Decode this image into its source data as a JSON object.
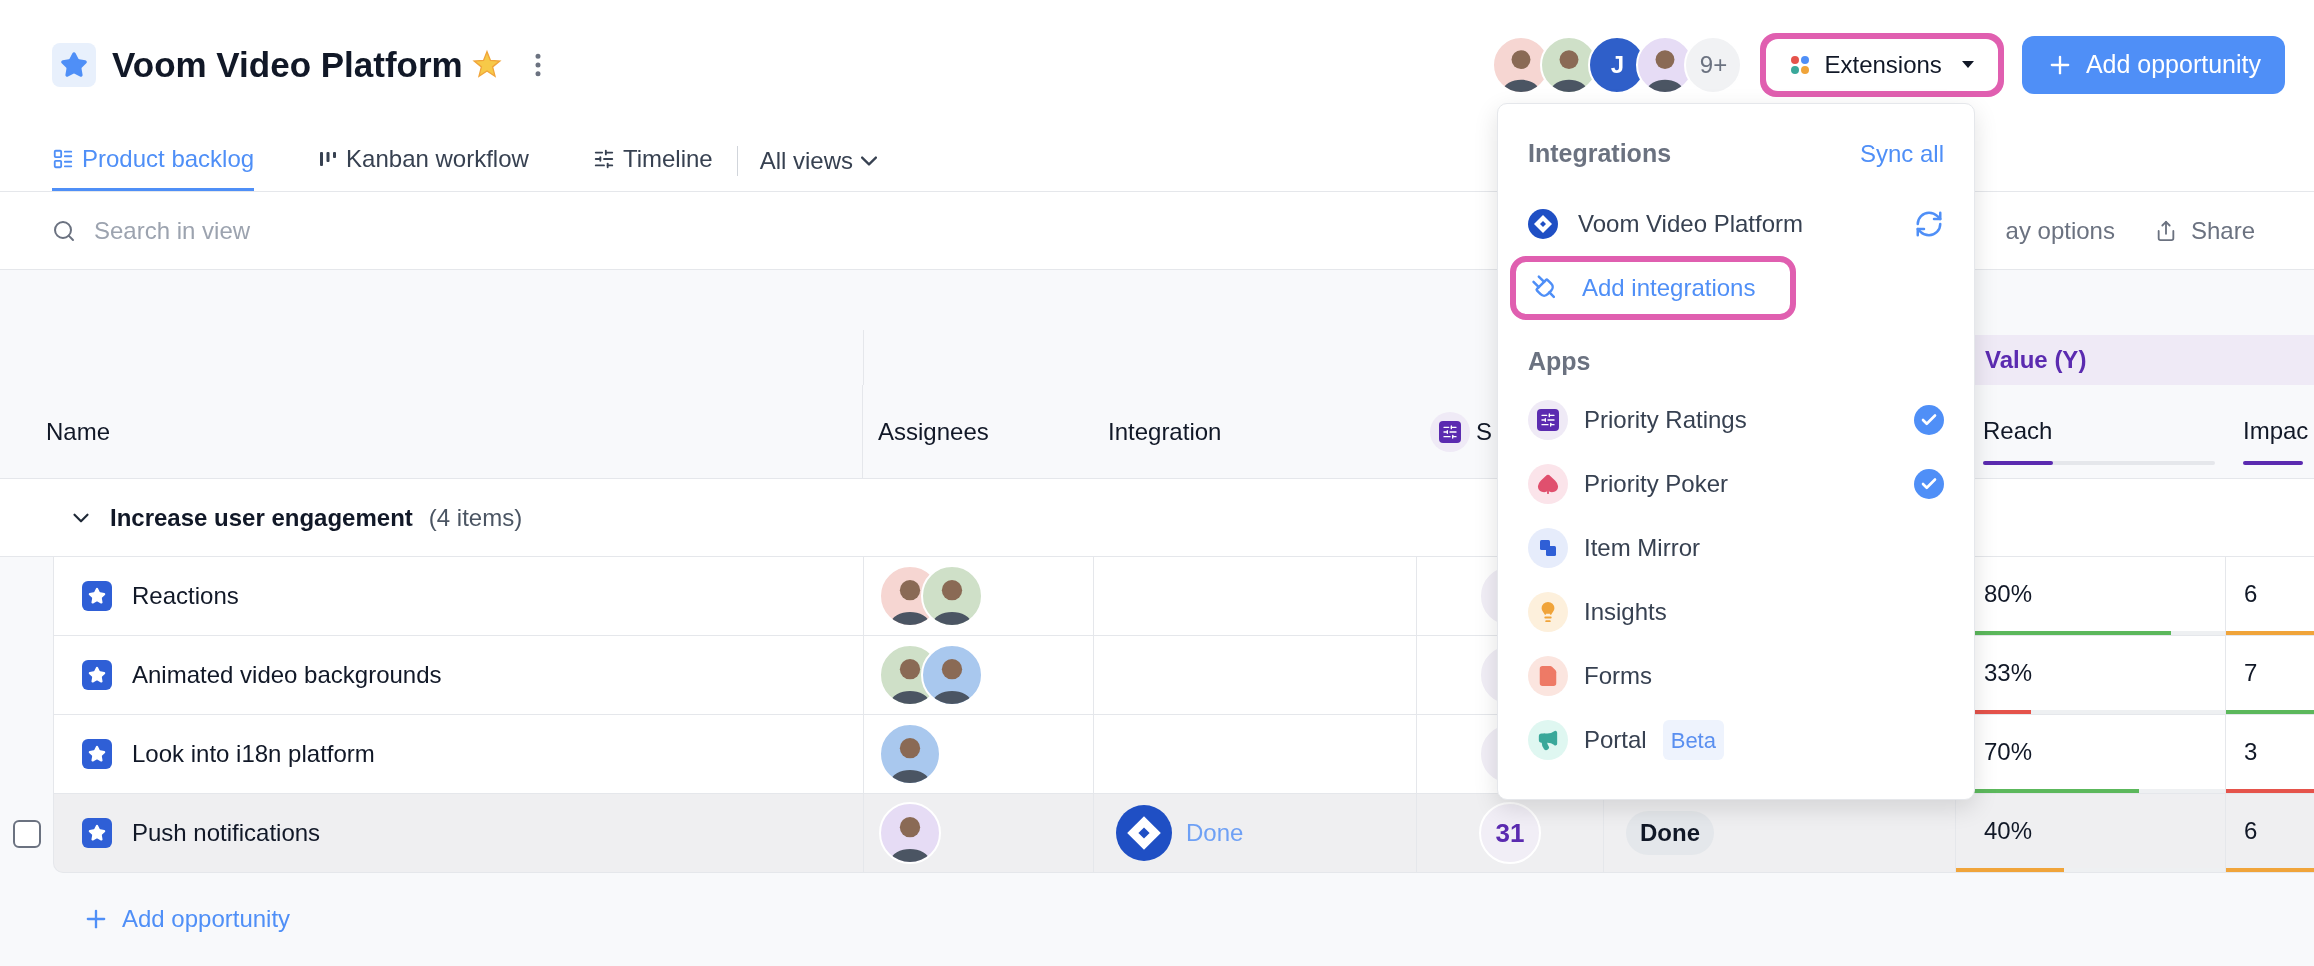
{
  "project": {
    "title": "Voom Video Platform"
  },
  "header_avatars": [
    {
      "kind": "photo"
    },
    {
      "kind": "photo"
    },
    {
      "kind": "initials",
      "text": "J"
    },
    {
      "kind": "photo"
    },
    {
      "kind": "more",
      "text": "9+"
    }
  ],
  "extensions_button": {
    "label": "Extensions",
    "highlighted": true
  },
  "add_button": {
    "label": "Add opportunity"
  },
  "tabs": [
    {
      "label": "Product backlog",
      "kind": "list",
      "selected": true
    },
    {
      "label": "Kanban workflow",
      "kind": "kanban",
      "selected": false
    },
    {
      "label": "Timeline",
      "kind": "timeline",
      "selected": false
    }
  ],
  "all_views": {
    "label": "All views"
  },
  "search": {
    "placeholder": "Search in view"
  },
  "toolbar": [
    {
      "label": "ay options",
      "kind": "display"
    },
    {
      "label": "Share",
      "kind": "share"
    }
  ],
  "table": {
    "group_header": "Value (Y)",
    "columns": [
      {
        "label": "Name",
        "kind": "name"
      },
      {
        "label": "Assignees",
        "kind": "assignees"
      },
      {
        "label": "Integration",
        "kind": "integration"
      },
      {
        "label": "S",
        "kind": "score"
      },
      {
        "label": "Reach",
        "kind": "reach",
        "level": 0.3
      },
      {
        "label": "Impac",
        "kind": "impact"
      }
    ],
    "group": {
      "title": "Increase user engagement",
      "count": "(4 items)",
      "expanded": true
    },
    "rows": [
      {
        "name": "Reactions",
        "hovered": false,
        "assignees": [
          {
            "kind": "photo"
          },
          {
            "kind": "photo"
          }
        ],
        "reach": {
          "value": "80%",
          "level": 0.8,
          "color": "#5cb85c"
        },
        "impact": {
          "value": "6",
          "color": "#f0a43a"
        }
      },
      {
        "name": "Animated video backgrounds",
        "hovered": false,
        "assignees": [
          {
            "kind": "photo"
          },
          {
            "kind": "photo"
          }
        ],
        "reach": {
          "value": "33%",
          "level": 0.28,
          "color": "#e5534b"
        },
        "impact": {
          "value": "7",
          "color": "#5cb85c"
        }
      },
      {
        "name": "Look into i18n platform",
        "hovered": false,
        "assignees": [
          {
            "kind": "photo"
          }
        ],
        "reach": {
          "value": "70%",
          "level": 0.68,
          "color": "#5cb85c"
        },
        "impact": {
          "value": "3",
          "color": "#e5534b"
        }
      },
      {
        "name": "Push notifications",
        "hovered": true,
        "checked": false,
        "assignees": [
          {
            "kind": "photo"
          }
        ],
        "integration": {
          "status": "Done"
        },
        "score": "31",
        "status": "Done",
        "reach": {
          "value": "40%",
          "level": 0.4,
          "color": "#f0a43a"
        },
        "impact": {
          "value": "6",
          "color": "#f0a43a"
        }
      }
    ],
    "add_link": "Add opportunity"
  },
  "dropdown": {
    "integrations_title": "Integrations",
    "sync_all": "Sync all",
    "integrations": [
      {
        "label": "Voom Video Platform",
        "kind": "jira"
      }
    ],
    "add_integrations": {
      "label": "Add integrations",
      "highlighted": true
    },
    "apps_title": "Apps",
    "apps": [
      {
        "label": "Priority Ratings",
        "kind": "ratings",
        "checked": true
      },
      {
        "label": "Priority Poker",
        "kind": "poker",
        "checked": true
      },
      {
        "label": "Item Mirror",
        "kind": "mirror",
        "checked": false
      },
      {
        "label": "Insights",
        "kind": "insights",
        "checked": false
      },
      {
        "label": "Forms",
        "kind": "forms",
        "checked": false
      },
      {
        "label": "Portal",
        "kind": "portal",
        "checked": false,
        "badge": "Beta"
      }
    ]
  }
}
